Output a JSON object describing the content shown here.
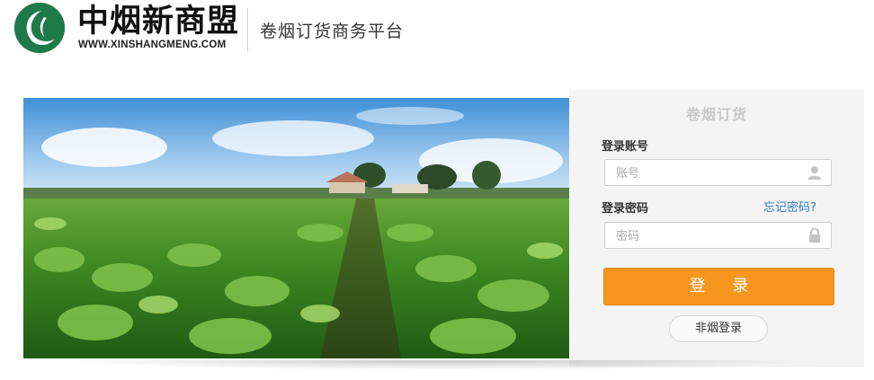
{
  "header": {
    "brand_name": "中烟新商盟",
    "brand_url": "WWW.XINSHANGMENG.COM",
    "platform_name": "卷烟订货商务平台",
    "logo_icon": "leaf-logo-icon"
  },
  "banner": {
    "image_subject": "tobacco-field-photo"
  },
  "login": {
    "title": "卷烟订货",
    "account_label": "登录账号",
    "account_placeholder": "账号",
    "password_label": "登录密码",
    "password_placeholder": "密码",
    "forgot_password": "忘记密码?",
    "login_button": "登 录",
    "non_tobacco_login": "非烟登录",
    "account_icon": "user-icon",
    "password_icon": "lock-icon"
  },
  "colors": {
    "brand_green": "#1f7a4a",
    "login_orange": "#f7961e",
    "link_blue": "#2a7bc8"
  }
}
